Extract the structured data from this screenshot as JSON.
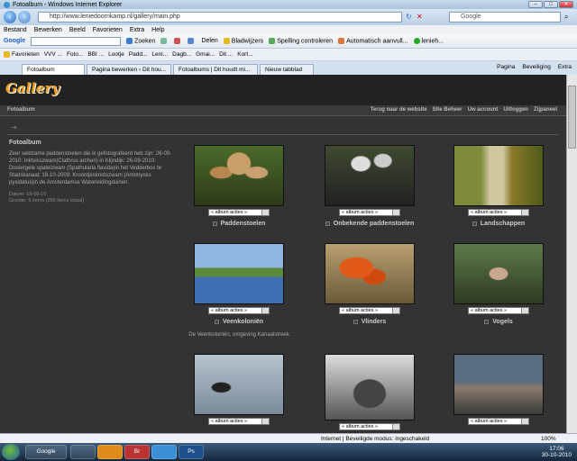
{
  "window": {
    "title": "Fotoalbum - Windows Internet Explorer",
    "min": "–",
    "max": "□",
    "close": "✕"
  },
  "address": {
    "url": "http://www.leniedoornkamp.nl/gallery/main.php",
    "search_placeholder": "Google"
  },
  "menu": [
    "Bestand",
    "Bewerken",
    "Beeld",
    "Favorieten",
    "Extra",
    "Help"
  ],
  "googlebar": {
    "label": "Google",
    "zoeken": "Zoeken",
    "delen": "Delen",
    "bladwijzers": "Bladwijzers",
    "spelling": "Spelling controleren",
    "autofill": "Automatisch aanvull...",
    "user": "lenieh..."
  },
  "favbar": {
    "label": "Favorieten",
    "items": [
      "VVV ...",
      "Foto...",
      "BBI ...",
      "Lootje",
      "Padd...",
      "Leni...",
      "Dagb...",
      "Gmai...",
      "Dit ...",
      "Kort..."
    ]
  },
  "tabs": [
    "Fotoalbum",
    "Pagina bewerken ‹ Dit hou...",
    "Fotoalbums | Dit houdt mi...",
    "Nieuw tabblad"
  ],
  "cmd": {
    "pagina": "Pagina",
    "beveiliging": "Beveiliging",
    "extra": "Extra"
  },
  "gallery": {
    "logo": "Gallery",
    "crumb": "Fotoalbum",
    "sitemenu": [
      "Terug naar de website",
      "Site Beheer",
      "Uw account",
      "Uitloggen",
      "Zijpaneel"
    ],
    "side": {
      "title": "Fotoalbum",
      "text": "Zeer seldzame paddenstoelen die ik gefotografeerd heb zijn: 26-09-2010: Inktvisszwam(Clathrus archeri) in Klijndijk; 26-09-2010: Dooiergele spatelzwam (Spathularia flavida)in het Vedderbos te Stadskanaal; 18-10-2009: Kroontjesknotszwam (Artomyces pyxidatus)in de Amsterdamse Waterleidingduinen.",
      "date": "Datum: 19-08-10",
      "size": "Grootte: 9 items (296 items totaal)"
    },
    "select_label": "« album acties »",
    "items": [
      {
        "title": "Paddenstoelen",
        "desc": ""
      },
      {
        "title": "Onbekende paddenstoelen",
        "desc": ""
      },
      {
        "title": "Landschappen",
        "desc": ""
      },
      {
        "title": "Veenkoloniën",
        "desc": "De Veenkoloniën, omgeving Kanaalstreek"
      },
      {
        "title": "Vlinders",
        "desc": ""
      },
      {
        "title": "Vogels",
        "desc": ""
      },
      {
        "title": "",
        "desc": ""
      },
      {
        "title": "",
        "desc": ""
      },
      {
        "title": "",
        "desc": ""
      }
    ]
  },
  "status": {
    "zone": "Internet | Beveiligde modus: ingeschakeld",
    "zoom": "100%"
  },
  "taskbar": {
    "google": "Google",
    "time": "17:06",
    "date": "30-10-2010",
    "apps": [
      "Br",
      "Ps"
    ]
  }
}
